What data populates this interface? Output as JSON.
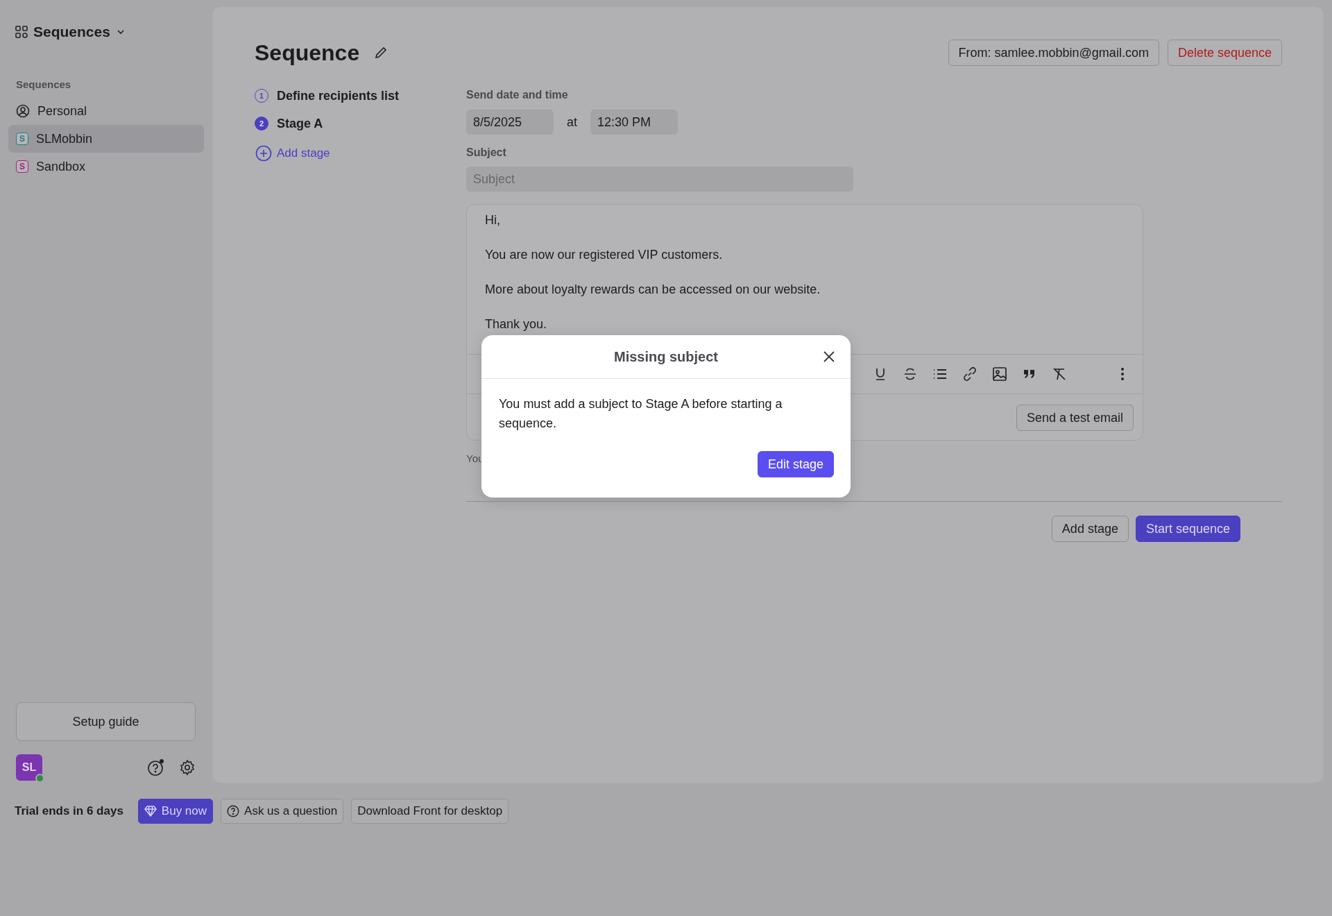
{
  "sidebar": {
    "title": "Sequences",
    "section_label": "Sequences",
    "items": [
      {
        "label": "Personal",
        "kind": "personal",
        "selected": false
      },
      {
        "label": "SLMobbin",
        "kind": "team",
        "badge": "S",
        "color": "#1f7f86",
        "selected": true
      },
      {
        "label": "Sandbox",
        "kind": "team",
        "badge": "S",
        "color": "#a8237e",
        "selected": false
      }
    ],
    "setup_button": "Setup guide",
    "avatar": {
      "initials": "SL",
      "online": true
    }
  },
  "bottom_bar": {
    "trial": "Trial ends in 6 days",
    "buttons": [
      {
        "label": "Buy now",
        "kind": "primary"
      },
      {
        "label": "Ask us a question",
        "kind": "help"
      },
      {
        "label": "Download Front for desktop",
        "kind": "plain"
      }
    ]
  },
  "header": {
    "title": "Sequence",
    "from_button": "From: samlee.mobbin@gmail.com",
    "delete_button": "Delete sequence"
  },
  "steps": [
    {
      "number": "1",
      "label": "Define recipients list",
      "selected": false
    },
    {
      "number": "2",
      "label": "Stage A",
      "selected": true
    }
  ],
  "add_stage_link": "Add stage",
  "form": {
    "date_label": "Send date and time",
    "date": "8/5/2025",
    "at": "at",
    "time": "12:30 PM",
    "subject_label": "Subject",
    "subject_placeholder": "Subject",
    "body": [
      "Hi,",
      "You are now our registered VIP customers.",
      "More about loyalty rewards can be accessed on our website.",
      "Thank you."
    ],
    "test_button": "Send a test email",
    "note": "You"
  },
  "footer_buttons": {
    "add": "Add stage",
    "start": "Start sequence"
  },
  "modal": {
    "title": "Missing subject",
    "message": "You must add a subject to Stage A before starting a sequence.",
    "button": "Edit stage"
  }
}
